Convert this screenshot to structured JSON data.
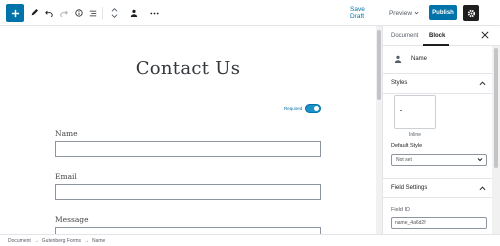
{
  "toolbar": {
    "save_draft": "Save Draft",
    "preview": "Preview",
    "publish": "Publish",
    "icons": [
      "plus-icon",
      "pencil-icon",
      "undo-icon",
      "redo-icon",
      "info-icon",
      "list-view-icon",
      "chevron-up-down-icon",
      "user-block-icon",
      "more-icon",
      "gear-icon"
    ],
    "accent": "#0073aa"
  },
  "canvas": {
    "title": "Contact Us",
    "required_label": "Required",
    "fields": [
      {
        "label": "Name"
      },
      {
        "label": "Email"
      },
      {
        "label": "Message"
      }
    ]
  },
  "sidebar": {
    "tabs": [
      "Document",
      "Block"
    ],
    "active_tab": "Block",
    "block_name": "Name",
    "styles_title": "Styles",
    "style_option": "Inline",
    "default_style_label": "Default Style",
    "default_style_value": "Not set",
    "field_settings_title": "Field Settings",
    "field_id_label": "Field ID",
    "field_id_value": "name_4a6d2f"
  },
  "breadcrumb": [
    "Document",
    "Gutenberg Forms",
    "Name"
  ],
  "breadcrumb_separator": "→"
}
